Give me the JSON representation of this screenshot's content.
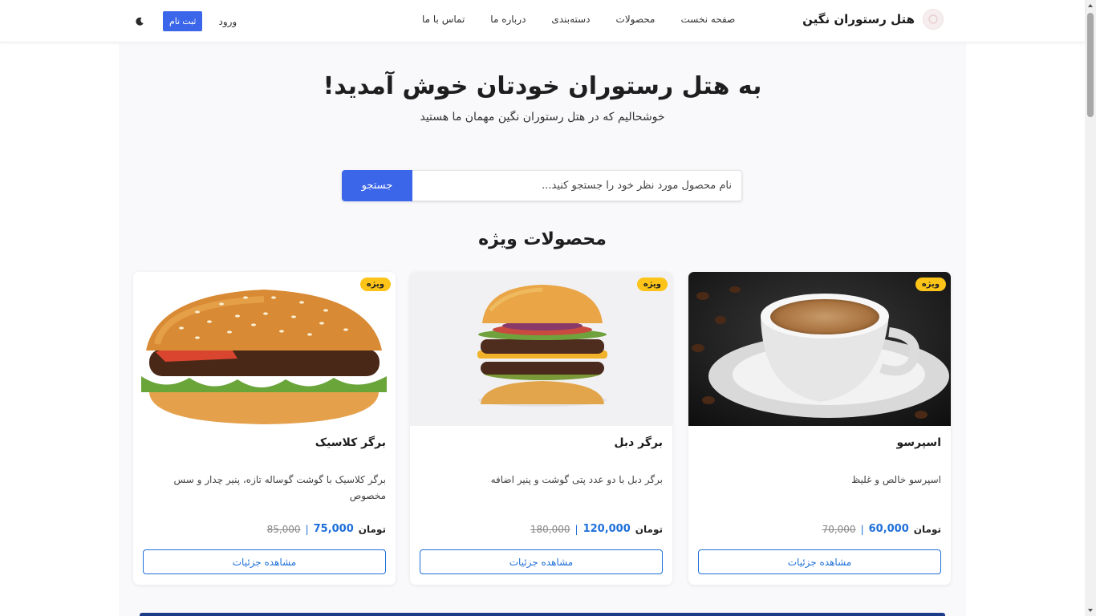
{
  "navbar": {
    "brand": "هتل رستوران نگین",
    "links": [
      "صفحه نخست",
      "محصولات",
      "دسته‌بندی",
      "درباره ما",
      "تماس با ما"
    ],
    "signup_label": "ثبت نام",
    "login_label": "ورود",
    "theme_icon": "moon-icon"
  },
  "hero": {
    "title": "به هتل رستوران خودتان خوش آمدید!",
    "subtitle": "خوشحالیم که در هتل رستوران نگین مهمان ما هستید"
  },
  "search": {
    "placeholder": "نام محصول مورد نظر خود را جستجو کنید...",
    "button_label": "جستجو"
  },
  "featured": {
    "title": "محصولات ویژه",
    "products": [
      {
        "badge": "ویژه",
        "name": "اسپرسو",
        "description": "اسپرسو خالص و غلیظ",
        "old_price": "70,000",
        "price": "60,000",
        "currency": "تومان",
        "separator": "|",
        "button_label": "مشاهده جزئیات"
      },
      {
        "badge": "ویژه",
        "name": "برگر دبل",
        "description": "برگر دبل با دو عدد پتی گوشت و پنیر اضافه",
        "old_price": "180,000",
        "price": "120,000",
        "currency": "تومان",
        "separator": "|",
        "button_label": "مشاهده جزئیات"
      },
      {
        "badge": "ویژه",
        "name": "برگر کلاسیک",
        "description": "برگر کلاسیک با گوشت گوساله تازه، پنیر چدار و سس مخصوص",
        "old_price": "85,000",
        "price": "75,000",
        "currency": "تومان",
        "separator": "|",
        "button_label": "مشاهده جزئیات"
      }
    ]
  },
  "colors": {
    "primary": "#3b66e9",
    "price": "#1e6fd9",
    "badge": "#fcc419"
  }
}
